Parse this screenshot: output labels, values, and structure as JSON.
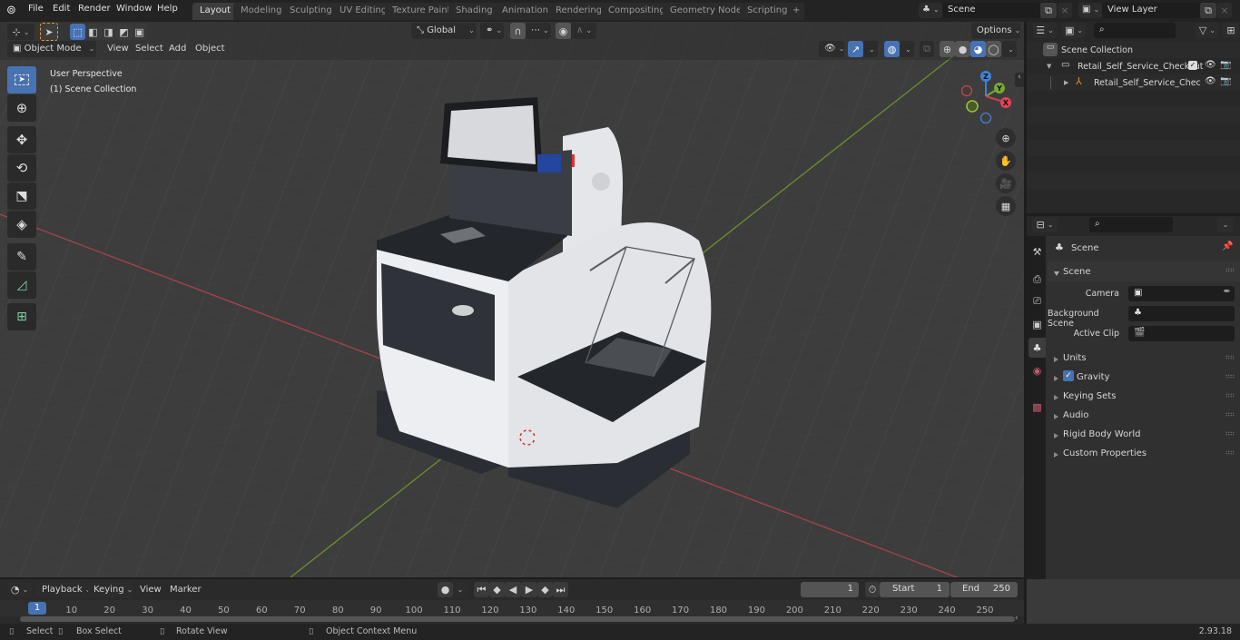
{
  "app": {
    "version": "2.93.18"
  },
  "topbar": {
    "menus": [
      "File",
      "Edit",
      "Render",
      "Window",
      "Help"
    ],
    "workspaces": [
      "Layout",
      "Modeling",
      "Sculpting",
      "UV Editing",
      "Texture Paint",
      "Shading",
      "Animation",
      "Rendering",
      "Compositing",
      "Geometry Nodes",
      "Scripting"
    ],
    "active_workspace": "Layout",
    "add_workspace": "+",
    "scene_name": "Scene",
    "view_layer_name": "View Layer"
  },
  "viewport": {
    "mode": "Object Mode",
    "header_menus": [
      "View",
      "Select",
      "Add",
      "Object"
    ],
    "transform_orientation": "Global",
    "options_label": "Options",
    "overlay_text": {
      "line1": "User Perspective",
      "line2": "(1) Scene Collection"
    },
    "tools": [
      "select-box",
      "cursor",
      "move",
      "rotate",
      "scale",
      "transform",
      "annotate",
      "measure",
      "add-cube"
    ],
    "gizmo": {
      "x": "X",
      "y": "Y",
      "z": "Z"
    },
    "colors": {
      "x_axis": "#c5434f",
      "y_axis": "#77a836",
      "z_axis": "#3e83d5",
      "grid_bg": "#3d3d3d",
      "accent": "#4772b3"
    }
  },
  "outliner": {
    "root": "Scene Collection",
    "items": [
      {
        "label": "Retail_Self_Service_Checkout",
        "type": "collection",
        "expanded": true,
        "checked": true
      },
      {
        "label": "Retail_Self_Service_Chec",
        "type": "armature",
        "expanded": false
      }
    ]
  },
  "properties": {
    "context_title": "Scene",
    "section_title": "Scene",
    "fields": [
      {
        "label": "Camera",
        "value": ""
      },
      {
        "label": "Background Scene",
        "value": ""
      },
      {
        "label": "Active Clip",
        "value": ""
      }
    ],
    "panels": [
      {
        "label": "Units"
      },
      {
        "label": "Gravity",
        "checkbox": true,
        "checked": true
      },
      {
        "label": "Keying Sets"
      },
      {
        "label": "Audio"
      },
      {
        "label": "Rigid Body World"
      },
      {
        "label": "Custom Properties"
      }
    ]
  },
  "timeline": {
    "menus": [
      "Playback",
      "Keying",
      "View",
      "Marker"
    ],
    "current_frame": "1",
    "start_label": "Start",
    "start": "1",
    "end_label": "End",
    "end": "250",
    "ticks": [
      "1",
      "10",
      "20",
      "30",
      "40",
      "50",
      "60",
      "70",
      "80",
      "90",
      "100",
      "110",
      "120",
      "130",
      "140",
      "150",
      "160",
      "170",
      "180",
      "190",
      "200",
      "210",
      "220",
      "230",
      "240",
      "250"
    ]
  },
  "statusbar": {
    "hints": [
      {
        "icon": "mouse-left-icon",
        "label": "Select"
      },
      {
        "icon": "mouse-drag-icon",
        "label": "Box Select"
      },
      {
        "icon": "mouse-middle-icon",
        "label": "Rotate View"
      },
      {
        "icon": "mouse-right-icon",
        "label": "Object Context Menu"
      }
    ]
  }
}
